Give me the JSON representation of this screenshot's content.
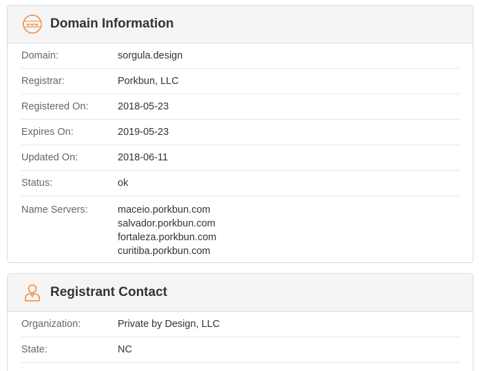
{
  "domain_panel": {
    "title": "Domain Information",
    "icon": "www-icon",
    "rows": [
      {
        "label": "Domain:",
        "value": "sorgula.design"
      },
      {
        "label": "Registrar:",
        "value": "Porkbun, LLC"
      },
      {
        "label": "Registered On:",
        "value": "2018-05-23"
      },
      {
        "label": "Expires On:",
        "value": "2019-05-23"
      },
      {
        "label": "Updated On:",
        "value": "2018-06-11"
      },
      {
        "label": "Status:",
        "value": "ok"
      }
    ],
    "name_servers": {
      "label": "Name Servers:",
      "values": [
        "maceio.porkbun.com",
        "salvador.porkbun.com",
        "fortaleza.porkbun.com",
        "curitiba.porkbun.com"
      ]
    }
  },
  "registrant_panel": {
    "title": "Registrant Contact",
    "icon": "person-icon",
    "rows": [
      {
        "label": "Organization:",
        "value": "Private by Design, LLC"
      },
      {
        "label": "State:",
        "value": "NC"
      }
    ]
  },
  "colors": {
    "accent": "#f08a3c",
    "header_bg": "#f5f5f5",
    "label": "#666666",
    "value": "#333333"
  }
}
